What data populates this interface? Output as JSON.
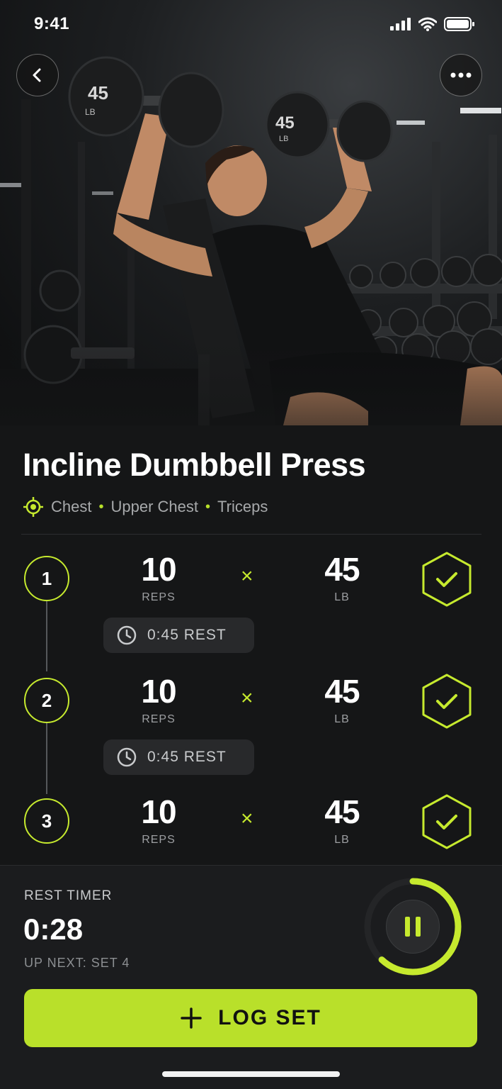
{
  "status": {
    "time": "9:41"
  },
  "hero": {
    "dumbbell_left_weight": "45",
    "dumbbell_right_weight": "45",
    "dumbbell_unit": "LB"
  },
  "exercise": {
    "title": "Incline Dumbbell Press",
    "muscles": [
      "Chest",
      "Upper Chest",
      "Triceps"
    ],
    "separator": "•"
  },
  "sets": [
    {
      "number": "1",
      "reps": "10",
      "reps_unit": "REPS",
      "times": "×",
      "weight": "45",
      "weight_unit": "LB",
      "completed": true
    },
    {
      "number": "2",
      "reps": "10",
      "reps_unit": "REPS",
      "times": "×",
      "weight": "45",
      "weight_unit": "LB",
      "completed": true
    },
    {
      "number": "3",
      "reps": "10",
      "reps_unit": "REPS",
      "times": "×",
      "weight": "45",
      "weight_unit": "LB",
      "completed": true
    }
  ],
  "rests": [
    {
      "label": "0:45 REST"
    },
    {
      "label": "0:45 REST"
    }
  ],
  "rest_timer": {
    "label": "REST TIMER",
    "time": "0:28",
    "up_next": "UP NEXT: SET 4",
    "progress": 0.62
  },
  "actions": {
    "log_set": "LOG SET",
    "log_set_icon": "plus-icon"
  },
  "colors": {
    "accent": "#c6ea2e",
    "button": "#b9e02a",
    "background": "#151617"
  },
  "icons": [
    "back-arrow-icon",
    "more-icon",
    "target-icon",
    "clock-icon",
    "check-hex-icon",
    "pause-icon",
    "plus-icon"
  ]
}
